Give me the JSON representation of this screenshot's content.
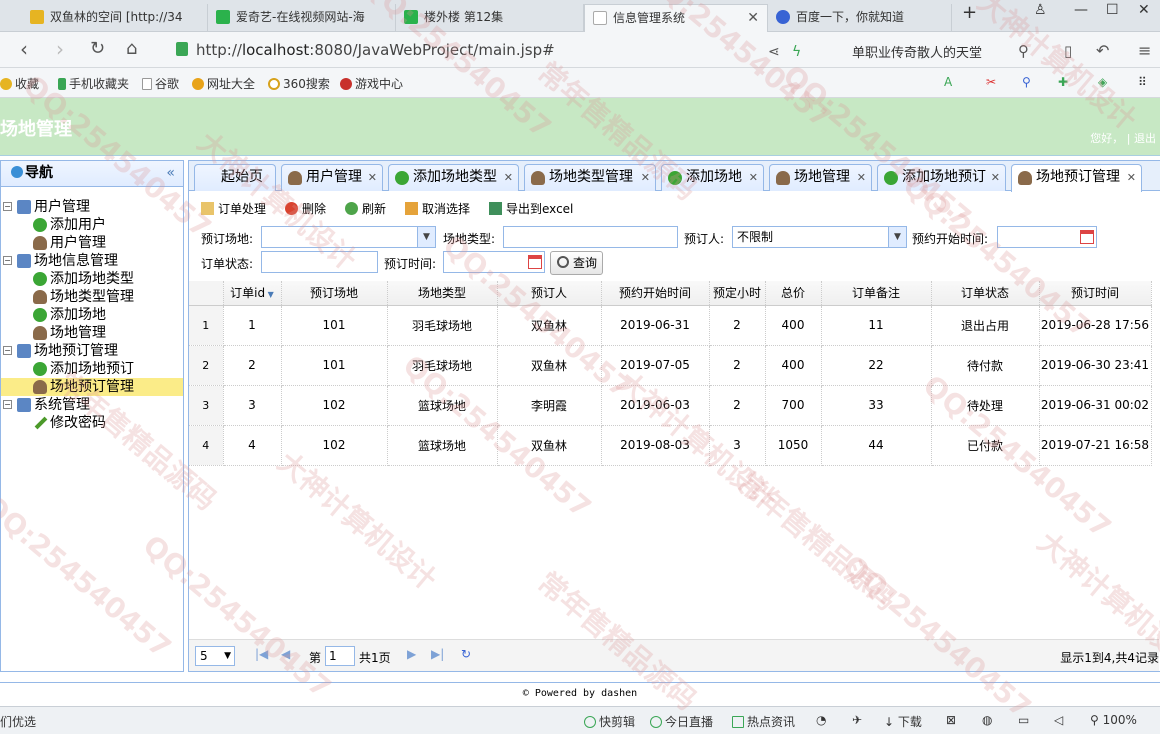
{
  "browser": {
    "tabs": [
      {
        "label": "双鱼林的空间 [http://34",
        "icon": "star-icon",
        "color": "#e6b422"
      },
      {
        "label": "爱奇艺-在线视频网站-海",
        "icon": "iqiyi-icon",
        "color": "#2bb24c"
      },
      {
        "label": "楼外楼 第12集",
        "icon": "iqiyi-icon",
        "color": "#2bb24c"
      },
      {
        "label": "信息管理系统",
        "icon": "page-icon",
        "color": "#bbbbbb"
      },
      {
        "label": "百度一下，你就知道",
        "icon": "baidu-icon",
        "color": "#3863d4"
      }
    ],
    "url_prefix": "http://",
    "url_host": "localhost",
    "url_rest": ":8080/JavaWebProject/main.jsp#",
    "search_text": "单职业传奇散人的天堂",
    "bookmarks": [
      "收藏",
      "手机收藏夹",
      "谷歌",
      "网址大全",
      "360搜索",
      "游戏中心"
    ]
  },
  "app": {
    "title": "场地管理",
    "user_greeting": "您好，",
    "logout": "退出"
  },
  "sidebar": {
    "title": "导航",
    "nodes": [
      {
        "label": "用户管理",
        "level": 0
      },
      {
        "label": "添加用户",
        "level": 1
      },
      {
        "label": "用户管理",
        "level": 1
      },
      {
        "label": "场地信息管理",
        "level": 0
      },
      {
        "label": "添加场地类型",
        "level": 1
      },
      {
        "label": "场地类型管理",
        "level": 1
      },
      {
        "label": "添加场地",
        "level": 1
      },
      {
        "label": "场地管理",
        "level": 1
      },
      {
        "label": "场地预订管理",
        "level": 0
      },
      {
        "label": "添加场地预订",
        "level": 1
      },
      {
        "label": "场地预订管理",
        "level": 1,
        "selected": true
      },
      {
        "label": "系统管理",
        "level": 0
      },
      {
        "label": "修改密码",
        "level": 1
      }
    ]
  },
  "tabs": [
    "起始页",
    "用户管理",
    "添加场地类型",
    "场地类型管理",
    "添加场地",
    "场地管理",
    "添加场地预订",
    "场地预订管理"
  ],
  "toolbar": {
    "process": "订单处理",
    "delete": "删除",
    "refresh": "刷新",
    "unselect": "取消选择",
    "export": "导出到excel"
  },
  "filters": {
    "venue_label": "预订场地:",
    "type_label": "场地类型:",
    "person_label": "预订人:",
    "person_value": "不限制",
    "start_label": "预约开始时间:",
    "status_label": "订单状态:",
    "order_time_label": "预订时间:",
    "query": "查询"
  },
  "grid": {
    "columns": [
      "订单id",
      "预订场地",
      "场地类型",
      "预订人",
      "预约开始时间",
      "预定小时",
      "总价",
      "订单备注",
      "订单状态",
      "预订时间"
    ],
    "rows": [
      [
        "1",
        "1",
        "101",
        "羽毛球场地",
        "双鱼林",
        "2019-06-31",
        "2",
        "400",
        "11",
        "退出占用",
        "2019-06-28 17:56"
      ],
      [
        "2",
        "2",
        "101",
        "羽毛球场地",
        "双鱼林",
        "2019-07-05",
        "2",
        "400",
        "22",
        "待付款",
        "2019-06-30 23:41"
      ],
      [
        "3",
        "3",
        "102",
        "篮球场地",
        "李明霞",
        "2019-06-03",
        "2",
        "700",
        "33",
        "待处理",
        "2019-06-31 00:02"
      ],
      [
        "4",
        "4",
        "102",
        "篮球场地",
        "双鱼林",
        "2019-08-03",
        "3",
        "1050",
        "44",
        "已付款",
        "2019-07-21 16:58"
      ]
    ]
  },
  "pager": {
    "page_size": "5",
    "page_prefix": "第",
    "page_value": "1",
    "page_suffix": "共1页",
    "summary": "显示1到4,共4记录"
  },
  "footer": "© Powered by dashen",
  "statusbar": [
    "们优选",
    "快剪辑",
    "今日直播",
    "热点资讯",
    "下载",
    "100%"
  ],
  "watermarks": [
    "QQ:254540457",
    "大神计算机设计",
    "常年售精品源码"
  ]
}
